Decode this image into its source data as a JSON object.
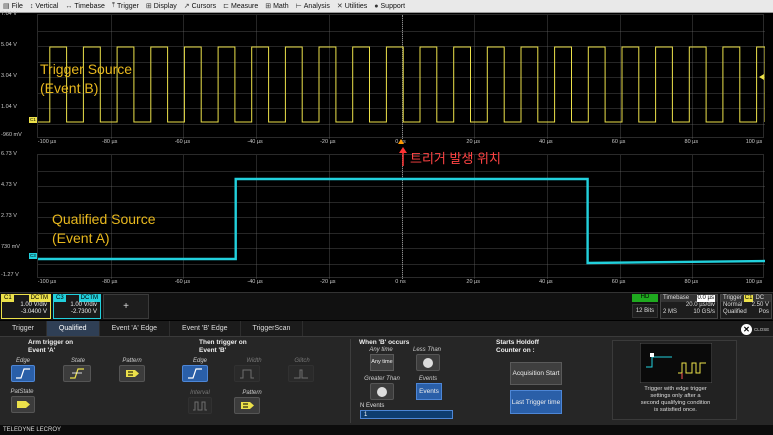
{
  "menu": [
    {
      "icon": "file-icon",
      "glyph": "▤",
      "label": "File"
    },
    {
      "icon": "vertical-icon",
      "glyph": "↕",
      "label": "Vertical"
    },
    {
      "icon": "timebase-icon",
      "glyph": "↔",
      "label": "Timebase"
    },
    {
      "icon": "trigger-icon",
      "glyph": "⤒",
      "label": "Trigger"
    },
    {
      "icon": "display-icon",
      "glyph": "⊞",
      "label": "Display"
    },
    {
      "icon": "cursors-icon",
      "glyph": "↗",
      "label": "Cursors"
    },
    {
      "icon": "measure-icon",
      "glyph": "⊏",
      "label": "Measure"
    },
    {
      "icon": "math-icon",
      "glyph": "⊞",
      "label": "Math"
    },
    {
      "icon": "analysis-icon",
      "glyph": "⊢",
      "label": "Analysis"
    },
    {
      "icon": "utilities-icon",
      "glyph": "✕",
      "label": "Utilities"
    },
    {
      "icon": "support-icon",
      "glyph": "●",
      "label": "Support"
    }
  ],
  "grid1": {
    "ylabels": [
      "7.04 V",
      "5.04 V",
      "3.04 V",
      "1.04 V",
      "-960 mV"
    ],
    "xlabels": [
      "-100 µs",
      "-80 µs",
      "-60 µs",
      "-40 µs",
      "-20 µs",
      "0 ns",
      "20 µs",
      "40 µs",
      "60 µs",
      "80 µs",
      "100 µs"
    ],
    "annotation_lines": [
      "Trigger Source",
      "(Event B)"
    ],
    "channel_tag": "C1"
  },
  "grid2": {
    "ylabels": [
      "6.73 V",
      "4.73 V",
      "2.73 V",
      "730 mV",
      "-1.27 V"
    ],
    "xlabels": [
      "-100 µs",
      "-80 µs",
      "-60 µs",
      "-40 µs",
      "-20 µs",
      "0 ns",
      "20 µs",
      "40 µs",
      "60 µs",
      "80 µs",
      "100 µs"
    ],
    "annotation_lines": [
      "Qualified Source",
      "(Event A)"
    ],
    "channel_tag": "C3"
  },
  "trigger_position_note": "트리거 발생 위치",
  "status": {
    "c1": {
      "name": "C1",
      "mode": "DCTM",
      "vdiv": "1.00 V/div",
      "offset": "-3.0400 V"
    },
    "c3": {
      "name": "C3",
      "mode": "DCTM",
      "vdiv": "1.00 V/div",
      "offset": "-2.7300 V"
    },
    "add": "+",
    "hd": "HD",
    "bits": "12 Bits",
    "timebase": {
      "label": "Timebase",
      "value": "0.0 µs",
      "div": "20.0 µs/div",
      "pts": "2 MS",
      "rate": "10 GS/s"
    },
    "trigger": {
      "label": "Trigger",
      "ch": "C1",
      "coupling": "DC",
      "mode": "Normal",
      "level": "2.50 V",
      "type": "Qualified",
      "slope": "Pos"
    }
  },
  "tabs": [
    "Trigger",
    "Qualified",
    "Event 'A' Edge",
    "Event 'B' Edge",
    "TriggerScan"
  ],
  "close_label": "CLOSE",
  "dialog": {
    "arm_title": [
      "Arm trigger on",
      "Event 'A'"
    ],
    "arm_buttons": [
      "Edge",
      "State",
      "Pattern",
      "PatState"
    ],
    "then_title": [
      "Then trigger on",
      "Event 'B'"
    ],
    "then_buttons": [
      "Edge",
      "Width",
      "Glitch",
      "Interval",
      "Pattern"
    ],
    "when_title": "When 'B' occurs",
    "when_buttons": [
      "Any time",
      "Less Than",
      "Greater Than",
      "Events"
    ],
    "nevents_label": "N Events",
    "nevents_value": "1",
    "holdoff_title": [
      "Starts Holdoff",
      "Counter on :"
    ],
    "holdoff_buttons": [
      "Acquisition Start",
      "Last Trigger time"
    ],
    "help_text": [
      "Trigger with edge trigger",
      "settings only after a",
      "second qualifying condition",
      "is satisfied once."
    ]
  },
  "brand": "TELEDYNE LECROY",
  "colors": {
    "c1": "#ece14a",
    "c3": "#22d0dc",
    "accent": "#2a5fa8",
    "annotation": "#e8b81e",
    "marker": "#ff3333"
  }
}
